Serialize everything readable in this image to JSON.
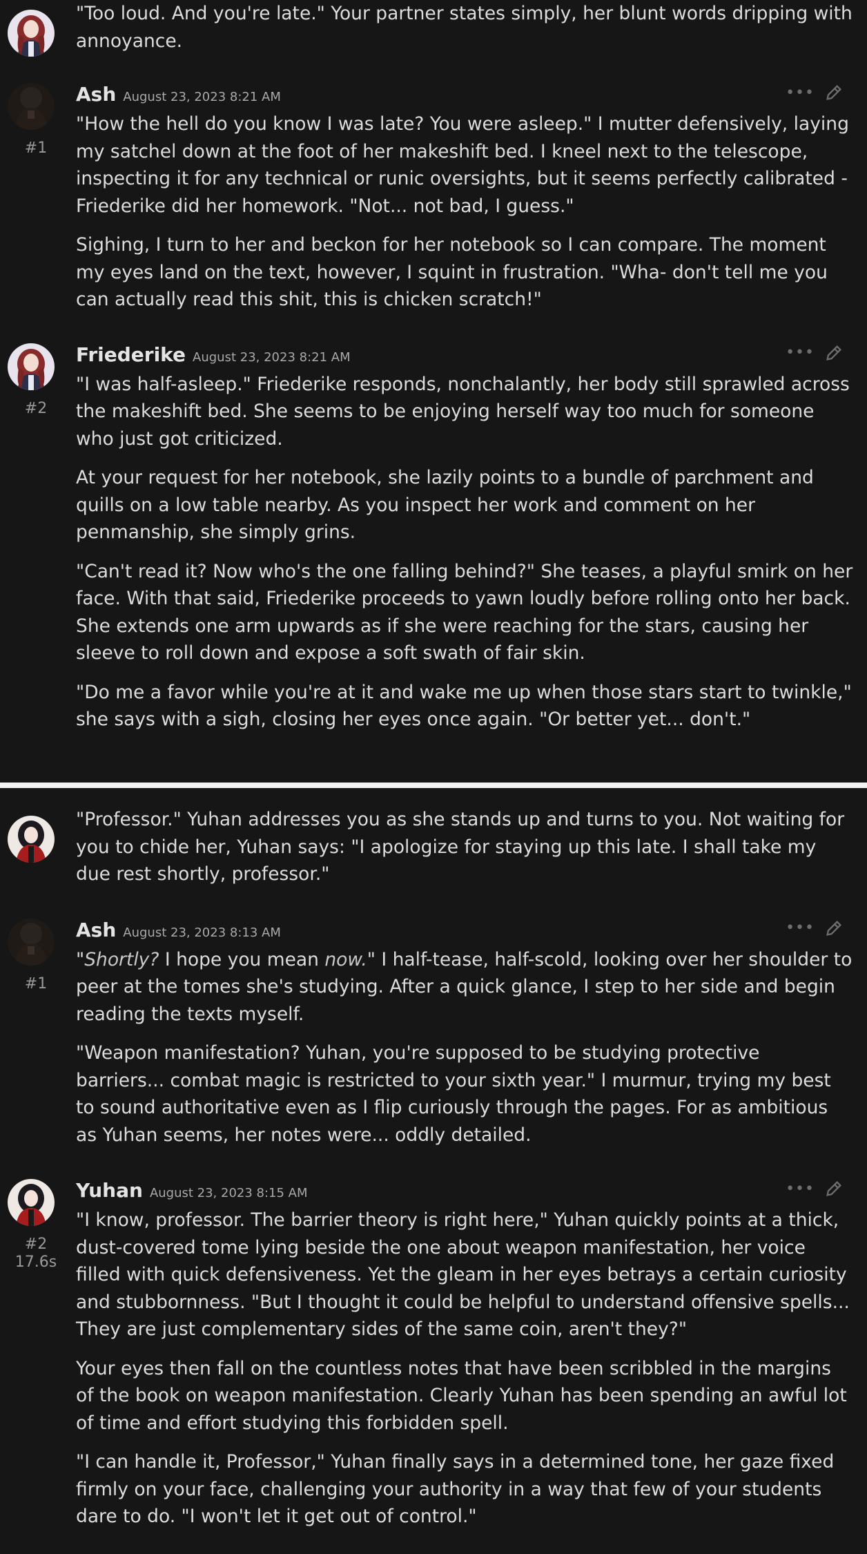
{
  "top": {
    "char_intro": {
      "paragraphs": [
        "\"Too loud. And you're late.\" Your partner states simply, her blunt words dripping with annoyance."
      ]
    },
    "msg1": {
      "name": "Ash",
      "date": "August 23, 2023 8:21 AM",
      "index": "#1",
      "paragraphs": [
        "\"How the hell do you know I was late? You were asleep.\" I mutter defensively, laying my satchel down at the foot of her makeshift bed. I kneel next to the telescope, inspecting it for any technical or runic oversights, but it seems perfectly calibrated - Friederike did her homework. \"Not... not bad, I guess.\"",
        "Sighing, I turn to her and beckon for her notebook so I can compare. The moment my eyes land on the text, however, I squint in frustration. \"Wha- don't tell me you can actually read this shit, this is chicken scratch!\""
      ]
    },
    "msg2": {
      "name": "Friederike",
      "date": "August 23, 2023 8:21 AM",
      "index": "#2",
      "paragraphs": [
        "\"I was half-asleep.\" Friederike responds, nonchalantly, her body still sprawled across the makeshift bed. She seems to be enjoying herself way too much for someone who just got criticized.",
        "At your request for her notebook, she lazily points to a bundle of parchment and quills on a low table nearby. As you inspect her work and comment on her penmanship, she simply grins.",
        "\"Can't read it? Now who's the one falling behind?\" She teases, a playful smirk on her face. With that said, Friederike proceeds to yawn loudly before rolling onto her back. She extends one arm upwards as if she were reaching for the stars, causing her sleeve to roll down and expose a soft swath of fair skin.",
        "\"Do me a favor while you're at it and wake me up when those stars start to twinkle,\" she says with a sigh, closing her eyes once again. \"Or better yet... don't.\""
      ]
    }
  },
  "bottom": {
    "char_intro": {
      "paragraphs": [
        "\"Professor.\" Yuhan addresses you as she stands up and turns to you. Not waiting for you to chide her, Yuhan says: \"I apologize for staying up this late. I shall take my due rest shortly, professor.\""
      ]
    },
    "msg1": {
      "name": "Ash",
      "date": "August 23, 2023 8:13 AM",
      "index": "#1",
      "p1_open": "\"",
      "p1_em1": "Shortly?",
      "p1_mid": " I hope you mean ",
      "p1_em2": "now.",
      "p1_rest": "\" I half-tease, half-scold, looking over her shoulder to peer at the tomes she's studying. After a quick glance, I step to her side and begin reading the texts myself.",
      "p2": "\"Weapon manifestation? Yuhan, you're supposed to be studying protective barriers... combat magic is restricted to your sixth year.\" I murmur, trying my best to sound authoritative even as I flip curiously through the pages. For as ambitious as Yuhan seems, her notes were... oddly detailed."
    },
    "msg2": {
      "name": "Yuhan",
      "date": "August 23, 2023 8:15 AM",
      "index": "#2",
      "timer": "17.6s",
      "paragraphs": [
        "\"I know, professor. The barrier theory is right here,\" Yuhan quickly points at a thick, dust-covered tome lying beside the one about weapon manifestation, her voice filled with quick defensiveness. Yet the gleam in her eyes betrays a certain curiosity and stubbornness. \"But I thought it could be helpful to understand offensive spells... They are just complementary sides of the same coin, aren't they?\"",
        "Your eyes then fall on the countless notes that have been scribbled in the margins of the book on weapon manifestation. Clearly Yuhan has been spending an awful lot of time and effort studying this forbidden spell.",
        "\"I can handle it, Professor,\" Yuhan finally says in a determined tone, her gaze fixed firmly on your face, challenging your authority in a way that few of your students dare to do. \"I won't let it get out of control.\""
      ]
    }
  },
  "icons": {
    "more": "more-dots-icon",
    "edit": "pencil-icon"
  },
  "colors": {
    "background": "#161616",
    "divider": "#f2f2f2",
    "text": "#dcdcdc",
    "muted": "#9a9a9a"
  }
}
